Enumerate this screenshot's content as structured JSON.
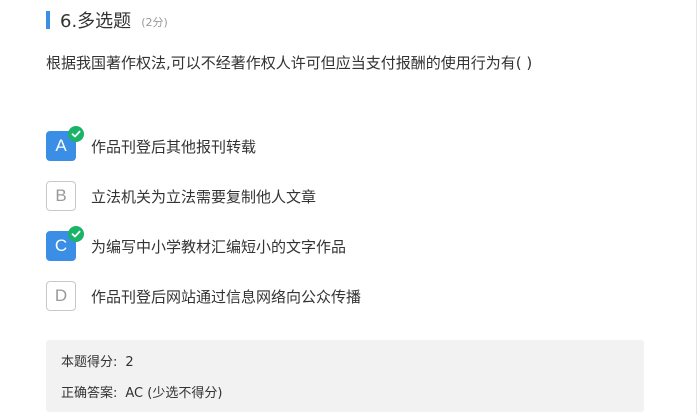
{
  "question": {
    "title": "6.多选题",
    "score": "(2分)",
    "stem": "根据我国著作权法,可以不经著作权人许可但应当支付报酬的使用行为有( )"
  },
  "options": [
    {
      "letter": "A",
      "text": "作品刊登后其他报刊转载",
      "selected": true
    },
    {
      "letter": "B",
      "text": "立法机关为立法需要复制他人文章",
      "selected": false
    },
    {
      "letter": "C",
      "text": "为编写中小学教材汇编短小的文字作品",
      "selected": true
    },
    {
      "letter": "D",
      "text": "作品刊登后网站通过信息网络向公众传播",
      "selected": false
    }
  ],
  "result": {
    "score_label": "本题得分:",
    "score_value": "2",
    "answer_label": "正确答案:",
    "answer_value": "AC (少选不得分)"
  },
  "colors": {
    "accent": "#3a8ee6",
    "check": "#1ab36a",
    "answer_bg": "#f2f2f2"
  },
  "icons": {
    "selected_mark": "check-circle-icon"
  }
}
